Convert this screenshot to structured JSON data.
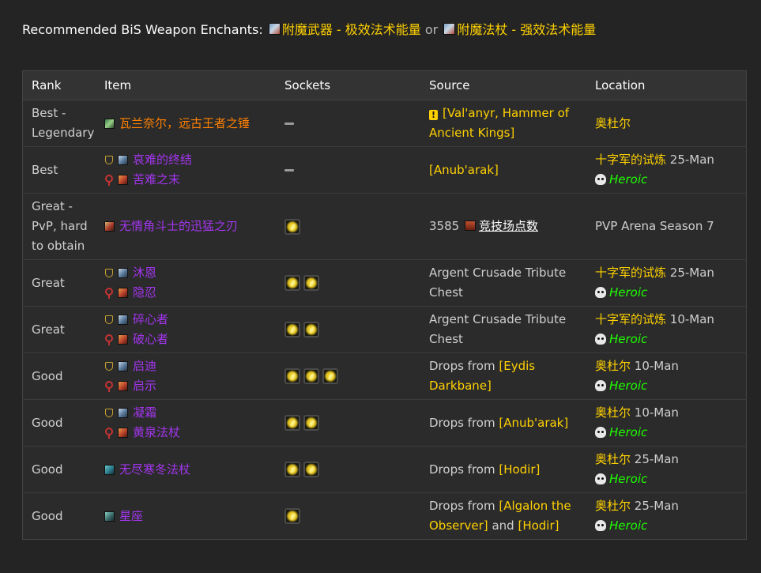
{
  "enchants": {
    "heading": "Recommended BiS Weapon Enchants",
    "colon": ":",
    "enchant1": "附魔武器 - 极效法术能量",
    "or": "or",
    "enchant2": "附魔法杖 - 强效法术能量"
  },
  "table": {
    "headers": [
      "Rank",
      "Item",
      "Sockets",
      "Source",
      "Location"
    ],
    "rows": [
      {
        "rank": "Best - Legendary",
        "items": [
          {
            "faction": "",
            "icon": "hammer-icon",
            "name": "瓦兰奈尔，远古王者之锤",
            "quality": "orange"
          }
        ],
        "sockets": 0,
        "source": {
          "prefix": "",
          "links": [
            "[Val'anyr, Hammer of Ancient Kings]"
          ],
          "quest": true
        },
        "location": {
          "zone": "奥杜尔",
          "size": "",
          "heroic": ""
        }
      },
      {
        "rank": "Best",
        "items": [
          {
            "faction": "alliance",
            "icon": "staff-icon",
            "name": "哀难的终结",
            "quality": "purple"
          },
          {
            "faction": "horde",
            "icon": "staff-icon",
            "name": "苦难之末",
            "quality": "purple"
          }
        ],
        "sockets": 0,
        "source": {
          "prefix": "",
          "links": [
            "[Anub'arak]"
          ]
        },
        "location": {
          "zone": "十字军的试炼",
          "size": "25-Man",
          "heroic": "Heroic"
        }
      },
      {
        "rank": "Great - PvP, hard to obtain",
        "items": [
          {
            "faction": "",
            "icon": "sword-icon",
            "name": "无情角斗士的迅猛之刃",
            "quality": "purple"
          }
        ],
        "sockets": 1,
        "source": {
          "arena_points": "3585",
          "arena_label": "竞技场点数"
        },
        "location": {
          "plain": "PVP Arena Season 7"
        }
      },
      {
        "rank": "Great",
        "items": [
          {
            "faction": "alliance",
            "icon": "staff-icon",
            "name": "沐恩",
            "quality": "purple"
          },
          {
            "faction": "horde",
            "icon": "staff-icon",
            "name": "隐忍",
            "quality": "purple"
          }
        ],
        "sockets": 2,
        "source": {
          "prefix": "Argent Crusade Tribute Chest",
          "links": []
        },
        "location": {
          "zone": "十字军的试炼",
          "size": "25-Man",
          "heroic": "Heroic"
        }
      },
      {
        "rank": "Great",
        "items": [
          {
            "faction": "alliance",
            "icon": "staff-icon",
            "name": "碎心者",
            "quality": "purple"
          },
          {
            "faction": "horde",
            "icon": "staff-icon",
            "name": "破心者",
            "quality": "purple"
          }
        ],
        "sockets": 2,
        "source": {
          "prefix": "Argent Crusade Tribute Chest",
          "links": []
        },
        "location": {
          "zone": "十字军的试炼",
          "size": "10-Man",
          "heroic": "Heroic"
        }
      },
      {
        "rank": "Good",
        "items": [
          {
            "faction": "alliance",
            "icon": "staff-icon",
            "name": "启迪",
            "quality": "purple"
          },
          {
            "faction": "horde",
            "icon": "staff-icon",
            "name": "启示",
            "quality": "purple"
          }
        ],
        "sockets": 3,
        "source": {
          "prefix": "Drops from",
          "links": [
            "[Eydis Darkbane]"
          ]
        },
        "location": {
          "zone": "奥杜尔",
          "size": "10-Man",
          "heroic": "Heroic"
        }
      },
      {
        "rank": "Good",
        "items": [
          {
            "faction": "alliance",
            "icon": "staff-icon",
            "name": "凝霜",
            "quality": "purple"
          },
          {
            "faction": "horde",
            "icon": "staff-icon",
            "name": "黄泉法杖",
            "quality": "purple"
          }
        ],
        "sockets": 2,
        "source": {
          "prefix": "Drops from",
          "links": [
            "[Anub'arak]"
          ]
        },
        "location": {
          "zone": "奥杜尔",
          "size": "10-Man",
          "heroic": "Heroic"
        }
      },
      {
        "rank": "Good",
        "items": [
          {
            "faction": "",
            "icon": "staff-icon",
            "name": "无尽寒冬法杖",
            "quality": "purple"
          }
        ],
        "sockets": 2,
        "source": {
          "prefix": "Drops from",
          "links": [
            "[Hodir]"
          ]
        },
        "location": {
          "zone": "奥杜尔",
          "size": "25-Man",
          "heroic": "Heroic"
        }
      },
      {
        "rank": "Good",
        "items": [
          {
            "faction": "",
            "icon": "staff-icon",
            "name": "星座",
            "quality": "purple"
          }
        ],
        "sockets": 1,
        "source": {
          "prefix": "Drops from",
          "links": [
            "[Algalon the Observer]",
            "[Hodir]"
          ],
          "joiner": "and"
        },
        "location": {
          "zone": "奥杜尔",
          "size": "25-Man",
          "heroic": "Heroic"
        }
      }
    ]
  }
}
